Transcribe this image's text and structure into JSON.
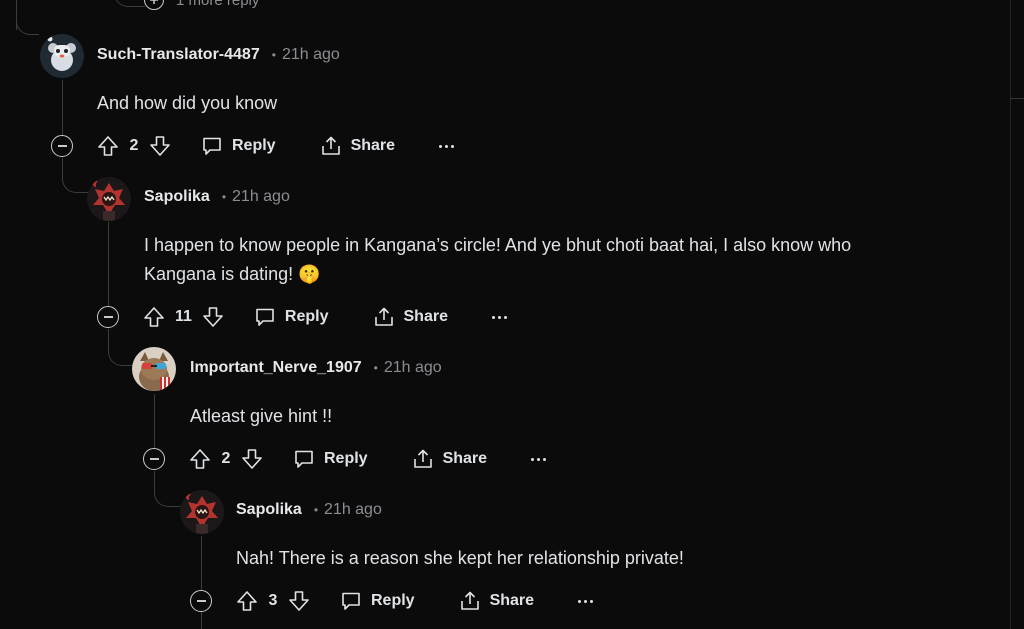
{
  "thread": {
    "more_replies_label": "1 more reply",
    "comments": [
      {
        "username": "Such-Translator-4487",
        "time": "21h ago",
        "body": [
          "And how did you know"
        ],
        "score": "2",
        "reply_label": "Reply",
        "share_label": "Share"
      },
      {
        "username": "Sapolika",
        "time": "21h ago",
        "body": [
          "I happen to know people in Kangana’s circle! And ye bhut choti baat hai, I also know who",
          "Kangana is dating! 🤫"
        ],
        "score": "11",
        "reply_label": "Reply",
        "share_label": "Share"
      },
      {
        "username": "Important_Nerve_1907",
        "time": "21h ago",
        "body": [
          "Atleast give hint !!"
        ],
        "score": "2",
        "reply_label": "Reply",
        "share_label": "Share"
      },
      {
        "username": "Sapolika",
        "time": "21h ago",
        "body": [
          "Nah! There is a reason she kept her relationship private!"
        ],
        "score": "3",
        "reply_label": "Reply",
        "share_label": "Share"
      }
    ]
  },
  "colors": {
    "background": "#0b0b0c",
    "text": "#e0e3e6",
    "muted": "#8a8d91",
    "thread_line": "#3a3c40"
  },
  "icons": [
    "plus-circle-icon",
    "upvote-icon",
    "downvote-icon",
    "comment-bubble-icon",
    "share-icon",
    "more-options-icon",
    "collapse-icon"
  ]
}
